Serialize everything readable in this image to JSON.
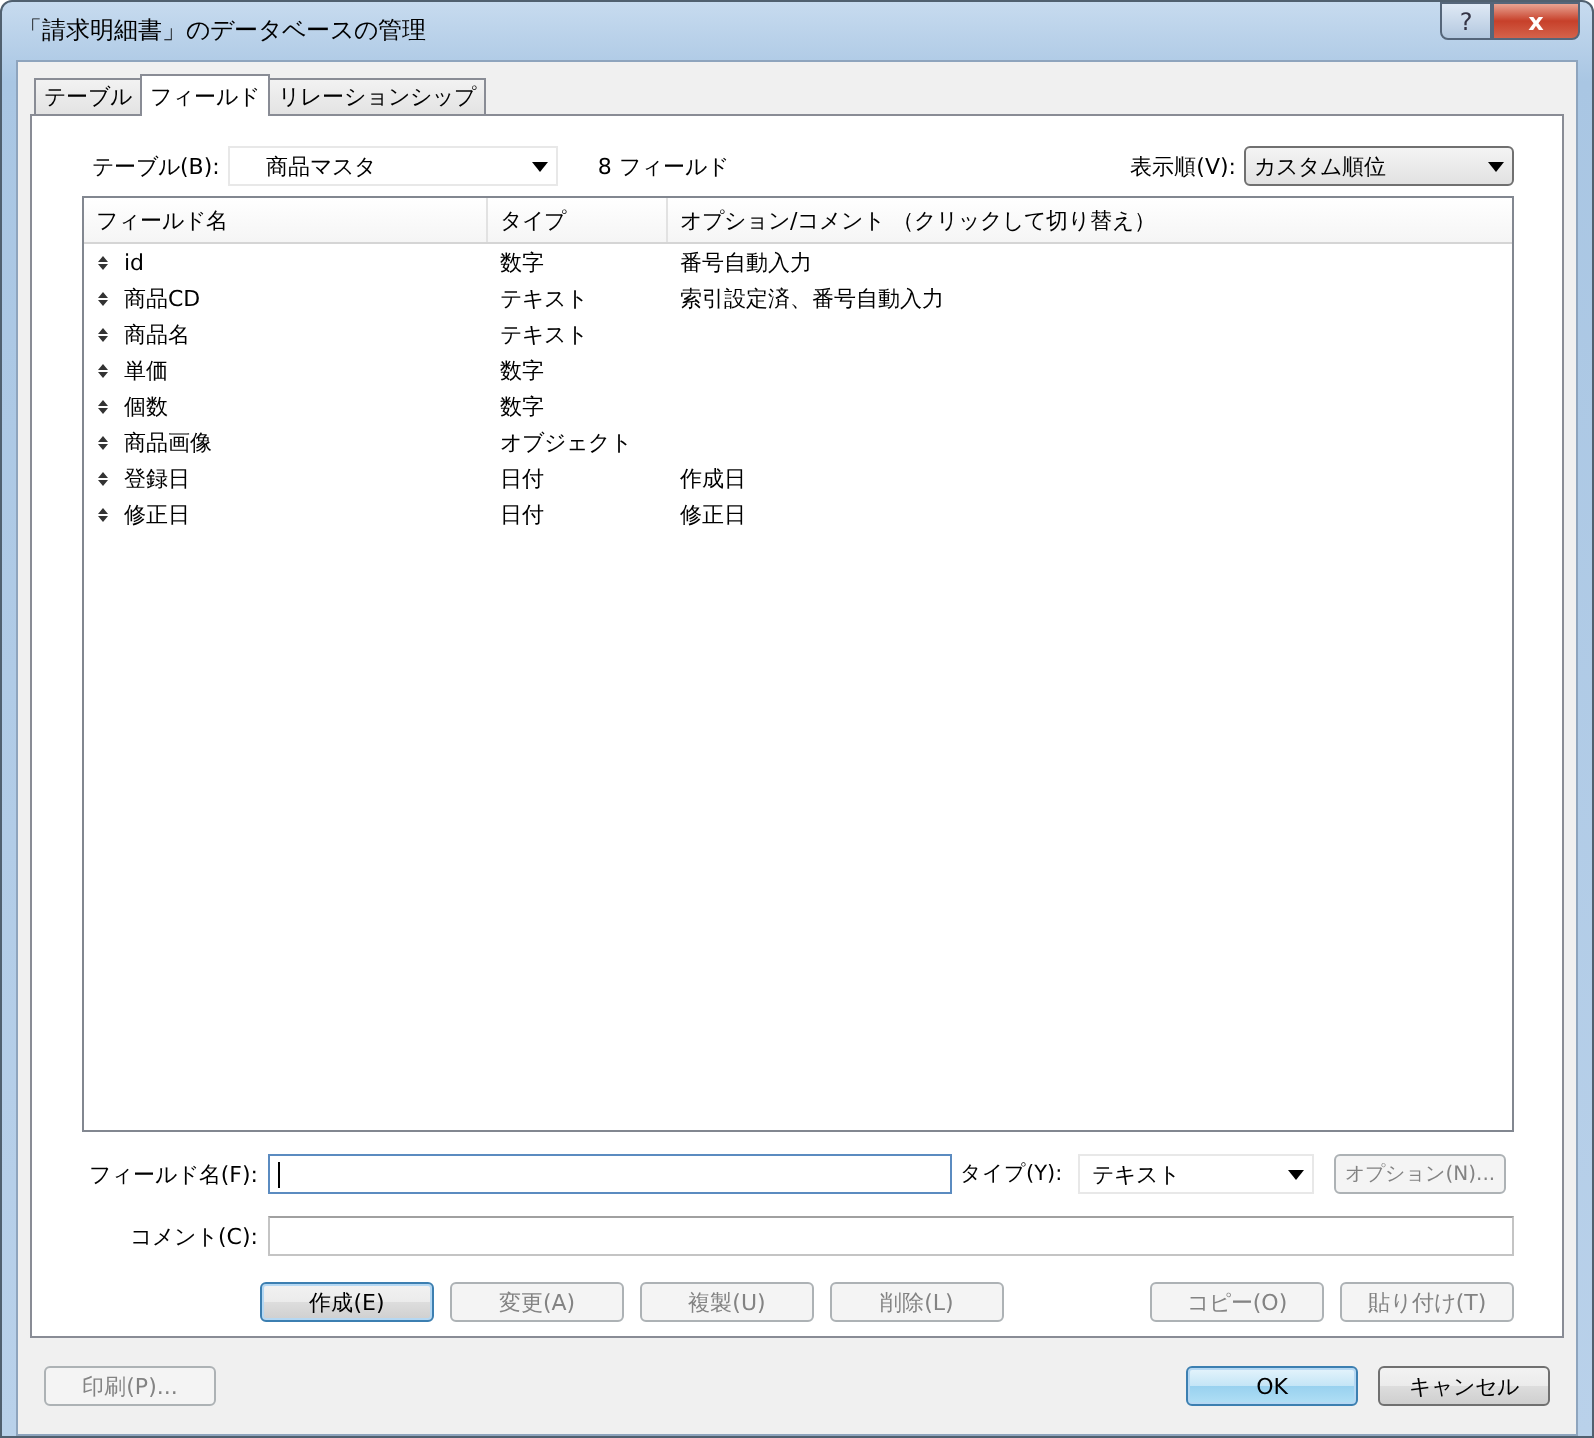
{
  "window": {
    "title": "「請求明細書」のデータベースの管理",
    "help_button": "?",
    "close_button": "x"
  },
  "tabs": [
    {
      "label": "テーブル",
      "selected": false
    },
    {
      "label": "フィールド",
      "selected": true
    },
    {
      "label": "リレーションシップ",
      "selected": false
    }
  ],
  "table_picker": {
    "label": "テーブル(B):",
    "value": "商品マスタ",
    "count": "8 フィールド"
  },
  "sort_picker": {
    "label": "表示順(V):",
    "value": "カスタム順位"
  },
  "field_list": {
    "columns": [
      "フィールド名",
      "タイプ",
      "オプション/コメント （クリックして切り替え）"
    ],
    "rows": [
      {
        "name": "id",
        "type": "数字",
        "options": "番号自動入力"
      },
      {
        "name": "商品CD",
        "type": "テキスト",
        "options": "索引設定済、番号自動入力"
      },
      {
        "name": "商品名",
        "type": "テキスト",
        "options": ""
      },
      {
        "name": "単価",
        "type": "数字",
        "options": ""
      },
      {
        "name": "個数",
        "type": "数字",
        "options": ""
      },
      {
        "name": "商品画像",
        "type": "オブジェクト",
        "options": ""
      },
      {
        "name": "登録日",
        "type": "日付",
        "options": "作成日"
      },
      {
        "name": "修正日",
        "type": "日付",
        "options": "修正日"
      }
    ]
  },
  "field_name": {
    "label": "フィールド名(F):"
  },
  "type_picker": {
    "label": "タイプ(Y):",
    "value": "テキスト"
  },
  "options_button": {
    "label": "オプション(N)...",
    "disabled": true
  },
  "comment": {
    "label": "コメント(C):"
  },
  "action_buttons": [
    {
      "label": "作成(E)",
      "disabled": false,
      "default": true
    },
    {
      "label": "変更(A)",
      "disabled": true,
      "default": false
    },
    {
      "label": "複製(U)",
      "disabled": true,
      "default": false
    },
    {
      "label": "削除(L)",
      "disabled": true,
      "default": false
    },
    {
      "label": "コピー(O)",
      "disabled": true,
      "default": false
    },
    {
      "label": "貼り付け(T)",
      "disabled": true,
      "default": false
    }
  ],
  "print_button": {
    "label": "印刷(P)...",
    "disabled": true
  },
  "dialog_buttons": [
    {
      "label": "OK",
      "disabled": false,
      "default": true
    },
    {
      "label": "キャンセル",
      "disabled": false,
      "default": false
    }
  ]
}
